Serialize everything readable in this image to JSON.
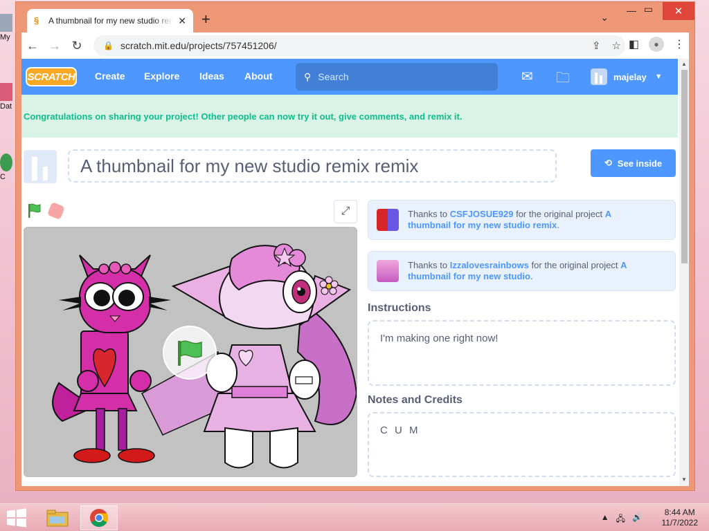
{
  "desktop": {
    "icons": [
      {
        "label": "My"
      },
      {
        "label": "Dat"
      },
      {
        "label": "C"
      }
    ]
  },
  "browser": {
    "tab_title": "A thumbnail for my new studio remix remix",
    "new_tab_label": "+",
    "url": "scratch.mit.edu/projects/757451206/"
  },
  "scratch": {
    "logo_text": "SCRATCH",
    "nav": {
      "create": "Create",
      "explore": "Explore",
      "ideas": "Ideas",
      "about": "About"
    },
    "search_placeholder": "Search",
    "username": "majelay",
    "banner": "Congratulations on sharing your project! Other people can now try it out, give comments, and remix it.",
    "project_title": "A thumbnail for my new studio remix remix",
    "see_inside": "See inside",
    "credits": [
      {
        "prefix": "Thanks to ",
        "user": "CSFJOSUE929",
        "middle": " for the original project ",
        "project": "A thumbnail for my new studio remix",
        "suffix": "."
      },
      {
        "prefix": "Thanks to ",
        "user": "Izzalovesrainbows",
        "middle": " for the original project ",
        "project": "A thumbnail for my new studio",
        "suffix": "."
      }
    ],
    "instructions_heading": "Instructions",
    "instructions_text": "I'm making one right now!",
    "notes_heading": "Notes and Credits",
    "notes_text": "C U M"
  },
  "taskbar": {
    "time": "8:44 AM",
    "date": "11/7/2022"
  },
  "colors": {
    "scratch_blue": "#4d97ff",
    "scratch_green": "#0fbd8c",
    "window_frame": "#ee9878"
  }
}
